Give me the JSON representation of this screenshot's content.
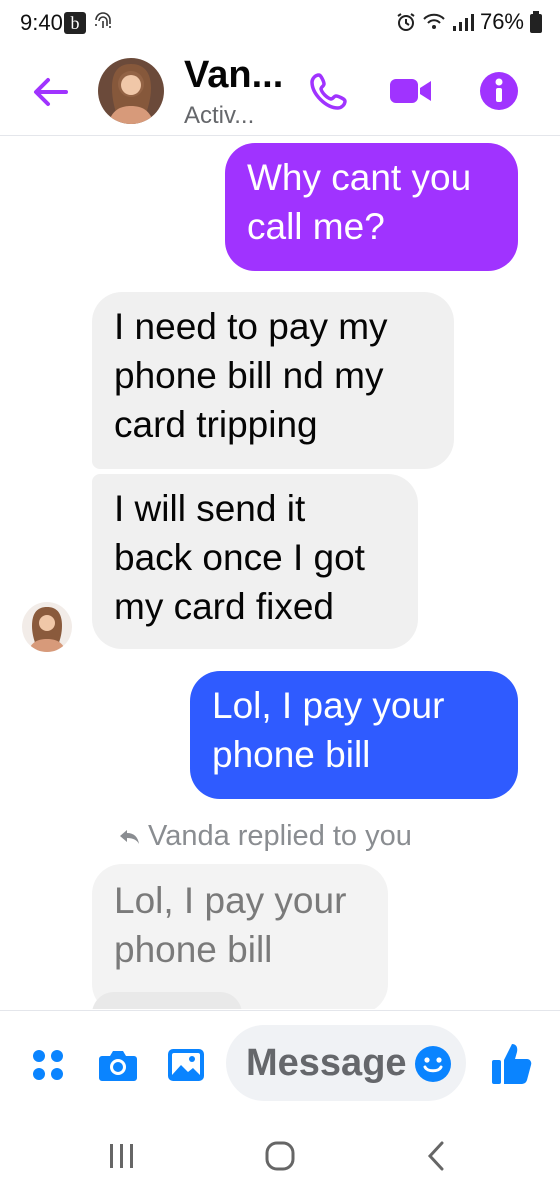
{
  "status_bar": {
    "time": "9:40",
    "b_badge": "b",
    "battery": "76%"
  },
  "header": {
    "contact_name": "Van...",
    "contact_status": "Activ...",
    "icons": [
      "back-arrow-icon",
      "phone-icon",
      "video-camera-icon",
      "info-icon"
    ]
  },
  "messages": [
    {
      "from": "me",
      "lines": [
        "Why cant you",
        "call me?"
      ]
    },
    {
      "from": "them",
      "lines": [
        "I need to pay my",
        "phone bill nd my",
        "card tripping"
      ]
    },
    {
      "from": "them",
      "lines": [
        "I will send it",
        "back once I got",
        "my card fixed"
      ]
    },
    {
      "from": "me",
      "lines": [
        "Lol, I pay your",
        "phone bill"
      ]
    }
  ],
  "reply_note": "Vanda replied to you",
  "quoted_message": {
    "lines": [
      "Lol, I pay your",
      "phone bill"
    ]
  },
  "composer": {
    "placeholder": "Message",
    "icons": [
      "apps-grid-icon",
      "camera-icon",
      "gallery-icon",
      "emoji-icon",
      "thumbs-up-icon"
    ]
  },
  "colors": {
    "accent": "#a033ff",
    "purple_bubble": "#a033ff",
    "blue_bubble": "#2f5bff",
    "composer_blue": "#0a84ff"
  },
  "nav_bar": {
    "icons": [
      "recents-icon",
      "home-icon",
      "back-icon"
    ]
  }
}
